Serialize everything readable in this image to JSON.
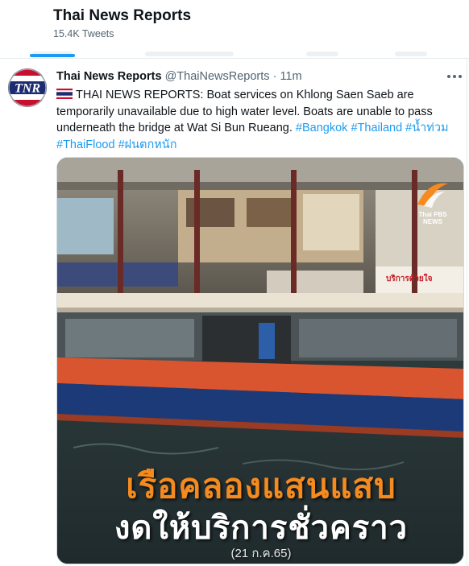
{
  "profile": {
    "name": "Thai News Reports",
    "tweet_count": "15.4K Tweets"
  },
  "tweet": {
    "author_name": "Thai News Reports",
    "handle": "@ThaiNewsReports",
    "separator": "·",
    "time": "11m",
    "avatar_text": "TNR",
    "text_prefix": "THAI NEWS REPORTS: Boat services on Khlong Saen Saeb are temporarily unavailable due to high water level. Boats are unable to pass underneath the bridge at Wat Si Bun Rueang. ",
    "hashtags": [
      "#Bangkok",
      "#Thailand",
      "#น้ำท่วม",
      "#ThaiFlood",
      "#ฝนตกหนัก"
    ]
  },
  "media": {
    "caption_line1": "เรือคลองแสนแสบ",
    "caption_line2": "งดให้บริการชั่วคราว",
    "caption_date": "(21 ก.ค.65)",
    "logo_text": "Thai PBS NEWS",
    "sign_text": "บริการด้วยใจ"
  },
  "colors": {
    "accent": "#1d9bf0",
    "caption_orange": "#f58a1e",
    "boat_orange": "#d9552f",
    "boat_blue": "#1d3a78"
  },
  "icons": {
    "more": "more-horizontal-icon",
    "flag": "thailand-flag-icon"
  }
}
